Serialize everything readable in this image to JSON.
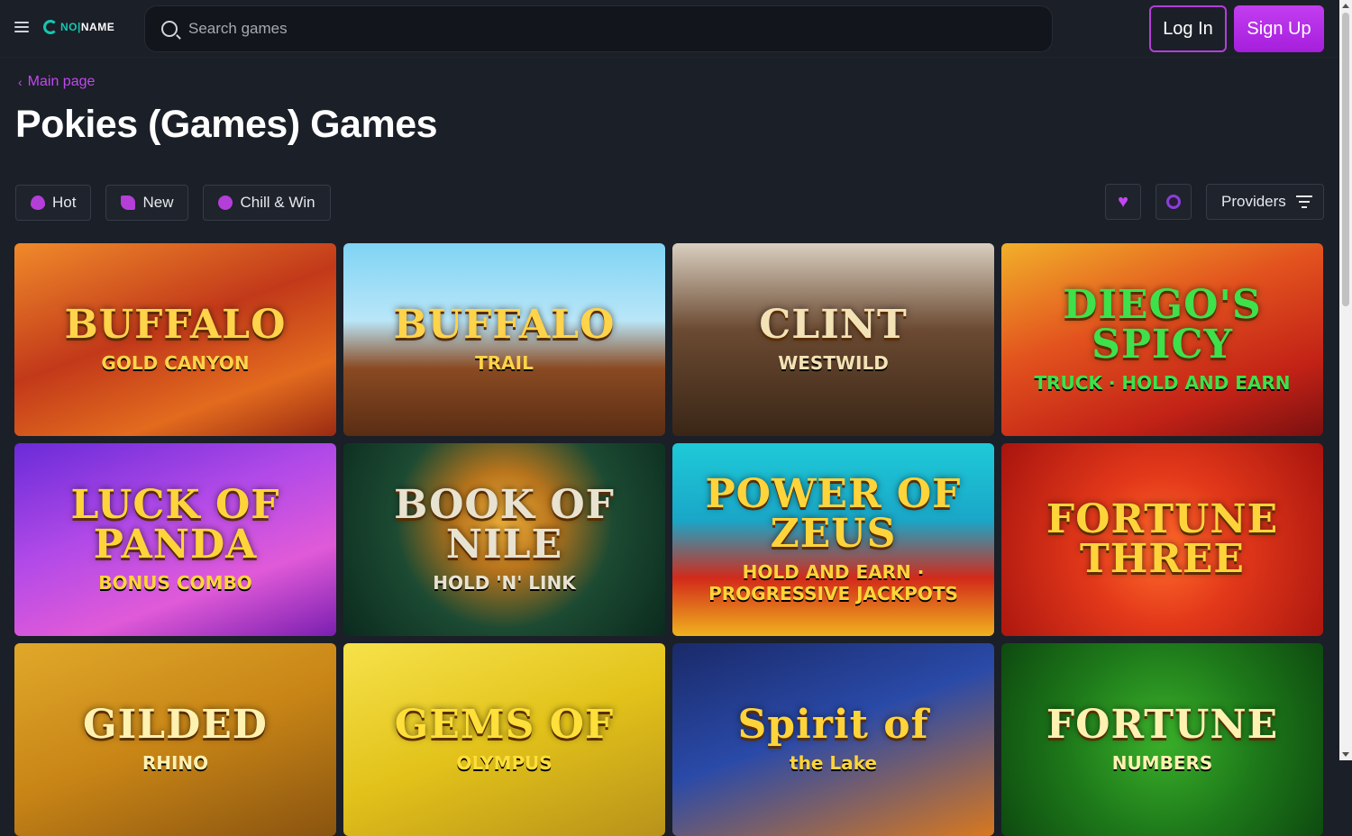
{
  "header": {
    "logo_text_a": "NO",
    "logo_text_b": "NAME",
    "search_placeholder": "Search games",
    "login_label": "Log In",
    "signup_label": "Sign Up"
  },
  "breadcrumb": {
    "back_label": "Main page"
  },
  "page_title": "Pokies (Games) Games",
  "filters": [
    {
      "label": "Hot",
      "icon": "flame-icon"
    },
    {
      "label": "New",
      "icon": "rocket-icon"
    },
    {
      "label": "Chill & Win",
      "icon": "cherries-icon"
    }
  ],
  "favorites_icon": "heart-icon",
  "recent_icon": "history-icon",
  "providers_label": "Providers",
  "games": [
    {
      "title": "BUFFALO",
      "subtitle": "GOLD CANYON",
      "bg": "linear-gradient(160deg,#f08a2a 0%,#c2391a 45%,#e26b1e 75%,#9a2a12 100%)",
      "color": "#ffd34a"
    },
    {
      "title": "BUFFALO",
      "subtitle": "TRAIL",
      "bg": "linear-gradient(180deg,#7fd4f4 0%,#b9e6f8 40%,#8a4a22 65%,#5a2d14 100%)",
      "color": "#ffd34a"
    },
    {
      "title": "CLINT",
      "subtitle": "WESTWILD",
      "bg": "linear-gradient(180deg,#d9cfc0 0%,#6b4a32 45%,#3a2616 100%)",
      "color": "#f3e2b5"
    },
    {
      "title": "DIEGO'S SPICY",
      "subtitle": "TRUCK · HOLD AND EARN",
      "bg": "linear-gradient(160deg,#f2b02a 0%,#e2521e 40%,#c22216 75%,#7a1010 100%)",
      "color": "#3ee14a"
    },
    {
      "title": "LUCK OF PANDA",
      "subtitle": "BONUS COMBO",
      "bg": "linear-gradient(160deg,#6a2bd8 0%,#b24ae8 40%,#e05ad8 70%,#7a1fb0 100%)",
      "color": "#ffd43a"
    },
    {
      "title": "BOOK OF NILE",
      "subtitle": "HOLD 'N' LINK",
      "bg": "radial-gradient(circle at 50% 40%,#f0b13a 0%,#b8741c 25%,#1c4a32 55%,#0b2a1e 100%)",
      "color": "#e8e2d0"
    },
    {
      "title": "POWER OF ZEUS",
      "subtitle": "HOLD AND EARN · PROGRESSIVE JACKPOTS",
      "bg": "linear-gradient(180deg,#1ecad8 0%,#1aa6c8 40%,#d22a1a 70%,#f0b21e 100%)",
      "color": "#ffd43a"
    },
    {
      "title": "FORTUNE THREE",
      "subtitle": "",
      "bg": "radial-gradient(circle at 50% 55%,#ff6a2a 0%,#e2381a 40%,#a8140e 100%)",
      "color": "#ffd43a"
    },
    {
      "title": "GILDED",
      "subtitle": "RHINO",
      "bg": "linear-gradient(160deg,#e0a82a 0%,#c88516 50%,#8a5410 100%)",
      "color": "#fff1b0"
    },
    {
      "title": "GEMS OF",
      "subtitle": "OLYMPUS",
      "bg": "linear-gradient(160deg,#f6e24a 0%,#e2c21a 50%,#b8921a 100%)",
      "color": "#ffdf3a"
    },
    {
      "title": "Spirit of",
      "subtitle": "the Lake",
      "bg": "linear-gradient(160deg,#1a2a6a 0%,#2a4aa8 45%,#d8781e 100%)",
      "color": "#ffd43a"
    },
    {
      "title": "FORTUNE",
      "subtitle": "NUMBERS",
      "bg": "radial-gradient(circle at 50% 50%,#3ab02a 0%,#1e7a1a 50%,#0e4a10 100%)",
      "color": "#fff1b0"
    }
  ]
}
